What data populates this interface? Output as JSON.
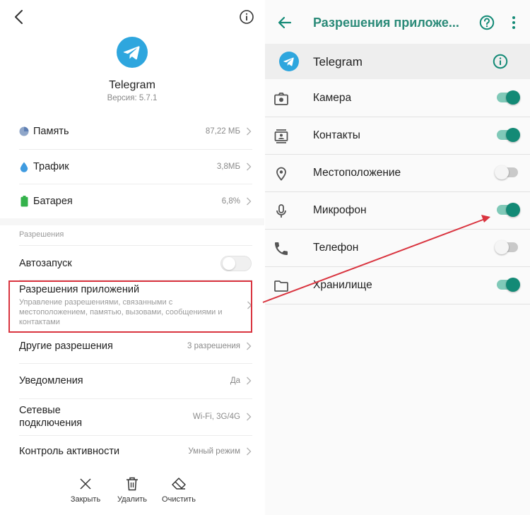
{
  "left": {
    "app_name": "Telegram",
    "version": "Версия: 5.7.1",
    "rows": [
      {
        "label": "Память",
        "value": "87,22 МБ",
        "icon": "pie-chart-icon"
      },
      {
        "label": "Трафик",
        "value": "3,8МБ",
        "icon": "drop-icon"
      },
      {
        "label": "Батарея",
        "value": "6,8%",
        "icon": "battery-icon"
      }
    ],
    "section_title": "Разрешения",
    "autostart_label": "Автозапуск",
    "autostart_enabled": false,
    "app_permissions": {
      "title": "Разрешения приложений",
      "description": "Управление разрешениями, связанными с местоположением, памятью, вызовами, сообщениями и контактами"
    },
    "other_rows": [
      {
        "label": "Другие разрешения",
        "value": "3 разрешения"
      },
      {
        "label": "Уведомления",
        "value": "Да"
      },
      {
        "label": "Сетевые подключения",
        "value": "Wi-Fi, 3G/4G"
      },
      {
        "label": "Контроль активности",
        "value": "Умный режим"
      }
    ],
    "bottom": {
      "close": "Закрыть",
      "delete": "Удалить",
      "clear": "Очистить"
    }
  },
  "right": {
    "title": "Разрешения приложе...",
    "app_name": "Telegram",
    "accent_color": "#138a76",
    "permissions": [
      {
        "label": "Камера",
        "enabled": true,
        "icon": "camera-icon"
      },
      {
        "label": "Контакты",
        "enabled": true,
        "icon": "contacts-icon"
      },
      {
        "label": "Местоположение",
        "enabled": false,
        "icon": "location-icon"
      },
      {
        "label": "Микрофон",
        "enabled": true,
        "icon": "microphone-icon"
      },
      {
        "label": "Телефон",
        "enabled": false,
        "icon": "phone-icon"
      },
      {
        "label": "Хранилище",
        "enabled": true,
        "icon": "folder-icon"
      }
    ]
  },
  "annotation_color": "#d9343f"
}
